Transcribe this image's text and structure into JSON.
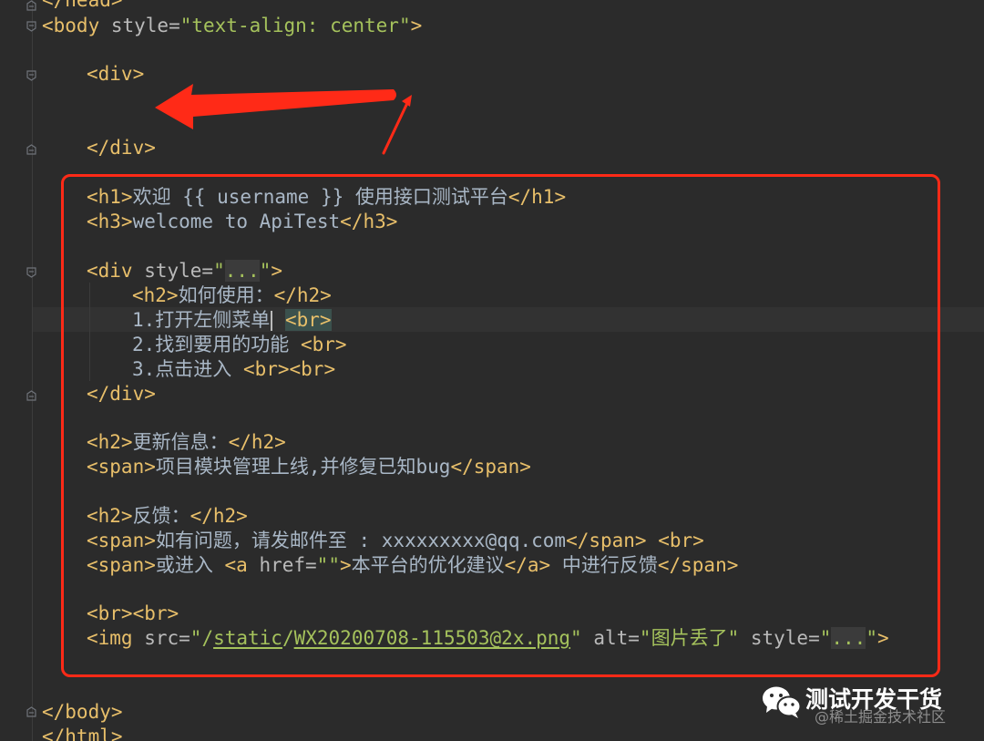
{
  "editor": {
    "cursor_line_color": "#323232",
    "lines": {
      "l0": {
        "t1": "</head>"
      },
      "l1": {
        "t1": "<body",
        "a1": " style=",
        "s1": "\"text-align: center\"",
        "t2": ">"
      },
      "l2": {
        "t1": "<div>"
      },
      "l3": {
        "t1": "</div>"
      },
      "l4": {
        "t1": "<h1>",
        "x1": "欢迎 {{ username }} 使用接口测试平台",
        "t2": "</h1>"
      },
      "l5": {
        "t1": "<h3>",
        "x1": "welcome to ApiTest",
        "t2": "</h3>"
      },
      "l6": {
        "t1": "<div",
        "a1": " style=",
        "s1": "\"",
        "ph": "...",
        "s2": "\"",
        "t2": ">"
      },
      "l7": {
        "t1": "<h2>",
        "x1": "如何使用：",
        "t2": "</h2>"
      },
      "l8": {
        "x1": "1.打开左侧菜单",
        "t1": "<br>"
      },
      "l9": {
        "x1": "2.找到要用的功能 ",
        "t1": "<br>"
      },
      "l10": {
        "x1": "3.点击进入 ",
        "t1": "<br><br>"
      },
      "l11": {
        "t1": "</div>"
      },
      "l12": {
        "t1": "<h2>",
        "x1": "更新信息：",
        "t2": "</h2>"
      },
      "l13": {
        "t1": "<span>",
        "x1": "项目模块管理上线,并修复已知bug",
        "t2": "</span>"
      },
      "l14": {
        "t1": "<h2>",
        "x1": "反馈：",
        "t2": "</h2>"
      },
      "l15": {
        "t1": "<span>",
        "x1": "如有问题，请发邮件至 : xxxxxxxxx@qq.com",
        "t2": "</span>",
        "x2": " ",
        "t3": "<br>"
      },
      "l16": {
        "t1": "<span>",
        "x1": "或进入 ",
        "t2": "<a",
        "a1": " href=",
        "s1": "\"\"",
        "t3": ">",
        "x2": "本平台的优化建议",
        "t4": "</a>",
        "x3": " 中进行反馈",
        "t5": "</span>"
      },
      "l17": {
        "t1": "<br><br>"
      },
      "l18": {
        "t1": "<img",
        "a1": " src=",
        "s1": "\"/",
        "s2": "static",
        "s3": "/",
        "s4": "WX20200708-115503@2x.png",
        "s5": "\"",
        "a2": " alt=",
        "s6": "\"图片丢了\"",
        "a3": " style=",
        "s7": "\"",
        "ph": "...",
        "s8": "\"",
        "t2": ">"
      },
      "l19": {
        "t1": "</body>"
      },
      "l20": {
        "t1": "</html>"
      }
    }
  },
  "annotation": {
    "color": "#ff2a17"
  },
  "watermark": {
    "brand": "测试开发干货",
    "community": "@稀土掘金技术社区",
    "icon": "wechat-icon"
  }
}
